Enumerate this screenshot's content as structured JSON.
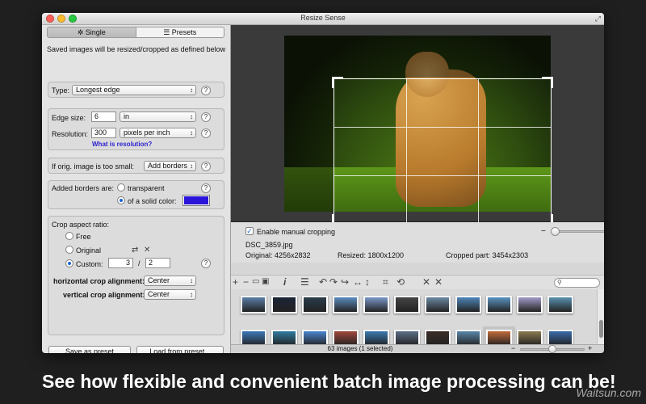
{
  "window": {
    "title": "Resize Sense"
  },
  "left_panel": {
    "tabs": [
      {
        "label": "Single",
        "icon": "gear-icon"
      },
      {
        "label": "Presets",
        "icon": "list-icon"
      }
    ],
    "description": "Saved images will be resized/cropped as defined below",
    "type_label": "Type:",
    "type_value": "Longest edge",
    "edge_size_label": "Edge size:",
    "edge_size_value": "6",
    "edge_size_unit": "in",
    "resolution_label": "Resolution:",
    "resolution_value": "300",
    "resolution_unit": "pixels per inch",
    "resolution_link": "What is resolution?",
    "too_small_label": "If orig. image is too small:",
    "too_small_value": "Add borders",
    "borders_label": "Added borders are:",
    "borders_transparent": "transparent",
    "borders_solid": "of a solid color:",
    "border_color": "#2b14d9",
    "crop_ratio_label": "Crop aspect ratio:",
    "ratio_free": "Free",
    "ratio_original": "Original",
    "ratio_custom": "Custom:",
    "ratio_w": "3",
    "ratio_sep": "/",
    "ratio_h": "2",
    "h_align_label": "horizontal crop alignment:",
    "h_align_value": "Center",
    "v_align_label": "vertical crop alignment:",
    "v_align_value": "Center",
    "save_preset": "Save as preset",
    "load_preset": "Load from preset..."
  },
  "preview": {
    "manual_crop_label": "Enable manual cropping",
    "file_name": "DSC_3859.jpg",
    "original": "Original: 4256x2832",
    "resized": "Resized: 1800x1200",
    "cropped": "Cropped part: 3454x2303",
    "zoom_level": 0.05
  },
  "thumbnails": {
    "colors": [
      "#5b7fa6",
      "#1a2436",
      "#2a3c4a",
      "#5c8cc0",
      "#7a98c8",
      "#444444",
      "#6d8aa4",
      "#4d86b8",
      "#5a94c2",
      "#a29ac8",
      "#5a92b0",
      "#3c78b8",
      "#2f7ca0",
      "#4a86d0",
      "#a0483c",
      "#3a7ab0",
      "#5c6e88",
      "#3a2c26",
      "#5a86a8",
      "#c06a3a",
      "#8a7a50",
      "#3a6aa8"
    ],
    "status": "63 images (1 selected)",
    "size_level": 0.5
  },
  "tagline": "See how flexible and convenient batch image processing can be!",
  "watermark": "Waitsun.com"
}
